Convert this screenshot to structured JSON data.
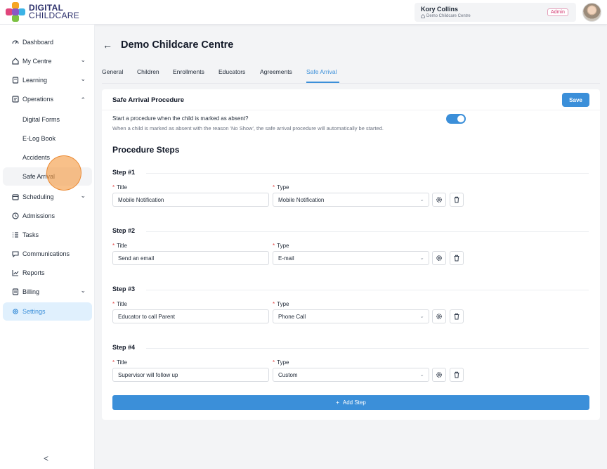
{
  "header": {
    "logo_line1": "DIGITAL",
    "logo_line2": "CHILDCARE",
    "user_name": "Kory Collins",
    "user_centre": "Demo Childcare Centre",
    "role": "Admin",
    "avatar_icon": "user-avatar"
  },
  "sidebar": {
    "items": [
      {
        "label": "Dashboard",
        "icon": "dashboard-icon"
      },
      {
        "label": "My Centre",
        "icon": "home-icon",
        "chevron": "⌄"
      },
      {
        "label": "Learning",
        "icon": "book-icon",
        "chevron": "⌄"
      },
      {
        "label": "Operations",
        "icon": "clipboard-icon",
        "chevron": "⌃"
      },
      {
        "label": "Digital Forms"
      },
      {
        "label": "E-Log Book"
      },
      {
        "label": "Accidents"
      },
      {
        "label": "Safe Arrival"
      },
      {
        "label": "Scheduling",
        "icon": "calendar-icon",
        "chevron": "⌄"
      },
      {
        "label": "Admissions",
        "icon": "admissions-icon"
      },
      {
        "label": "Tasks",
        "icon": "tasks-icon"
      },
      {
        "label": "Communications",
        "icon": "chat-icon"
      },
      {
        "label": "Reports",
        "icon": "chart-icon"
      },
      {
        "label": "Billing",
        "icon": "billing-icon",
        "chevron": "⌄"
      },
      {
        "label": "Settings",
        "icon": "gear-icon"
      }
    ],
    "collapse": "<"
  },
  "page": {
    "back": "←",
    "title": "Demo Childcare Centre"
  },
  "tabs": [
    "General",
    "Children",
    "Enrollments",
    "Educators",
    "Agreements",
    "Safe Arrival"
  ],
  "active_tab": "Safe Arrival",
  "card": {
    "title": "Safe Arrival Procedure",
    "save_label": "Save",
    "question": "Start a procedure when the child is marked as absent?",
    "help": "When a child is marked as absent with the reason 'No Show', the safe arrival procedure will automatically be started.",
    "toggle_on": true,
    "steps_heading": "Procedure Steps",
    "title_label": "Title",
    "type_label": "Type",
    "required_mark": "*",
    "steps": [
      {
        "label": "Step #1",
        "title": "Mobile Notification",
        "type": "Mobile Notification"
      },
      {
        "label": "Step #2",
        "title": "Send an email",
        "type": "E-mail"
      },
      {
        "label": "Step #3",
        "title": "Educator to call Parent",
        "type": "Phone Call"
      },
      {
        "label": "Step #4",
        "title": "Supervisor will follow up",
        "type": "Custom"
      }
    ],
    "add_step": "Add Step",
    "add_icon": "+"
  },
  "colors": {
    "accent": "#3b8fd9",
    "required": "#e04444",
    "admin_badge": "#d1306b"
  }
}
